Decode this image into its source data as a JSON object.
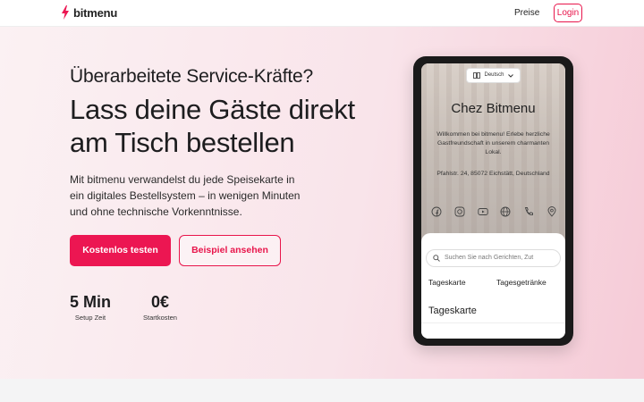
{
  "header": {
    "brand": "bitmenu",
    "nav_pricing": "Preise",
    "login": "Login",
    "brand_color": "#ec1652"
  },
  "hero": {
    "eyebrow": "Überarbeitete Service-Kräfte?",
    "headline": "Lass deine Gäste direkt am Tisch bestellen",
    "description": "Mit bitmenu verwandelst du jede Speisekarte in ein digitales Bestellsystem – in wenigen Minuten und ohne technische Vorkenntnisse.",
    "cta_primary": "Kostenlos testen",
    "cta_secondary": "Beispiel ansehen",
    "stats": [
      {
        "value": "5 Min",
        "label": "Setup Zeit"
      },
      {
        "value": "0€",
        "label": "Startkosten"
      }
    ]
  },
  "phone": {
    "language": "Deutsch",
    "restaurant_name": "Chez Bitmenu",
    "welcome": "Willkommen bei bitmenu! Erlebe herzliche Gastfreundschaft in unserem charmanten Lokal.",
    "address": "Pfahlstr. 24, 85072 Eichstätt, Deutschland",
    "social_icons": [
      "facebook-icon",
      "instagram-icon",
      "youtube-icon",
      "globe-icon",
      "phone-icon",
      "location-icon"
    ],
    "search_placeholder": "Suchen Sie nach Gerichten, Zut",
    "tabs": [
      "Tageskarte",
      "Tagesgetränke"
    ],
    "section_title": "Tageskarte"
  }
}
